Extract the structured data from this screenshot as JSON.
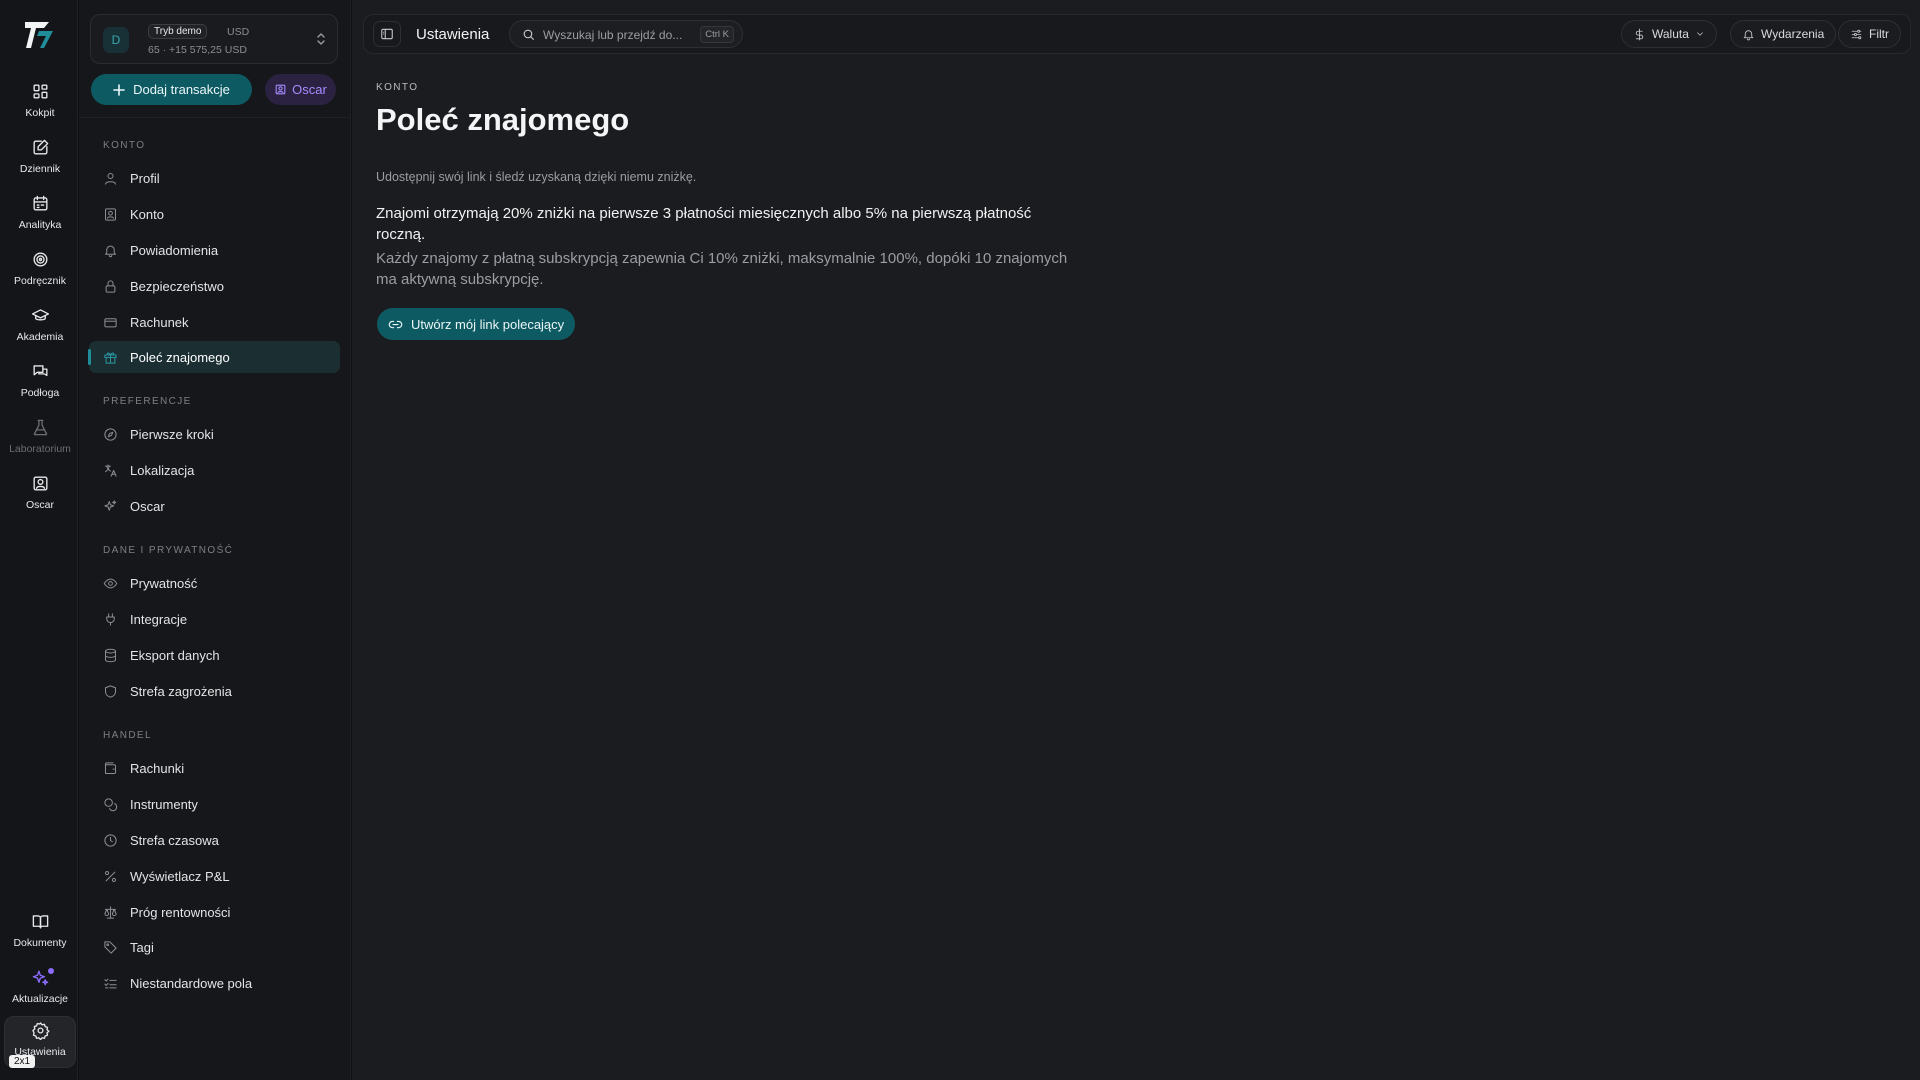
{
  "rail": {
    "items": [
      {
        "label": "Kokpit",
        "icon": "dashboard-icon"
      },
      {
        "label": "Dziennik",
        "icon": "journal-icon"
      },
      {
        "label": "Analityka",
        "icon": "calendar-icon"
      },
      {
        "label": "Podręcznik",
        "icon": "target-icon"
      },
      {
        "label": "Akademia",
        "icon": "graduation-cap-icon"
      },
      {
        "label": "Podłoga",
        "icon": "chat-icon"
      },
      {
        "label": "Laboratorium",
        "icon": "flask-icon"
      },
      {
        "label": "Oscar",
        "icon": "contact-card-icon"
      }
    ],
    "bottom": [
      {
        "label": "Dokumenty",
        "icon": "book-icon"
      },
      {
        "label": "Aktualizacje",
        "icon": "sparkle-icon"
      },
      {
        "label": "Ustawienia",
        "icon": "gear-icon"
      }
    ],
    "zoom_badge": "2x1"
  },
  "account": {
    "avatar": "D",
    "mode_badge": "Tryb demo",
    "currency": "USD",
    "balance": "65 · +15 575,25 USD"
  },
  "actions": {
    "add_transaction": "Dodaj transakcje",
    "oscar": "Oscar"
  },
  "sidebar": {
    "sections": [
      {
        "title": "KONTO",
        "items": [
          "Profil",
          "Konto",
          "Powiadomienia",
          "Bezpieczeństwo",
          "Rachunek",
          "Poleć znajomego"
        ]
      },
      {
        "title": "PREFERENCJE",
        "items": [
          "Pierwsze kroki",
          "Lokalizacja",
          "Oscar"
        ]
      },
      {
        "title": "DANE I PRYWATNOŚĆ",
        "items": [
          "Prywatność",
          "Integracje",
          "Eksport danych",
          "Strefa zagrożenia"
        ]
      },
      {
        "title": "HANDEL",
        "items": [
          "Rachunki",
          "Instrumenty",
          "Strefa czasowa",
          "Wyświetlacz P&L",
          "Próg rentowności",
          "Tagi",
          "Niestandardowe pola"
        ]
      }
    ],
    "active": "Poleć znajomego"
  },
  "topbar": {
    "title": "Ustawienia",
    "search_placeholder": "Wyszukaj lub przejdź do...",
    "shortcut": "Ctrl K",
    "currency_btn": "Waluta",
    "events_btn": "Wydarzenia",
    "filter_btn": "Filtr"
  },
  "page": {
    "breadcrumb": "KONTO",
    "title": "Poleć znajomego",
    "subtitle": "Udostępnij swój link i śledź uzyskaną dzięki niemu zniżkę.",
    "para1": "Znajomi otrzymają 20% zniżki na pierwsze 3 płatności miesięcznych albo 5% na pierwszą płatność roczną.",
    "para2": "Każdy znajomy z płatną subskrypcją zapewnia Ci 10% zniżki, maksymalnie 100%, dopóki 10 znajomych ma aktywną subskrypcję.",
    "cta": "Utwórz mój link polecający"
  },
  "colors": {
    "accent": "#0e5a63",
    "oscar": "#a88bff",
    "background": "#1b1c1f"
  }
}
